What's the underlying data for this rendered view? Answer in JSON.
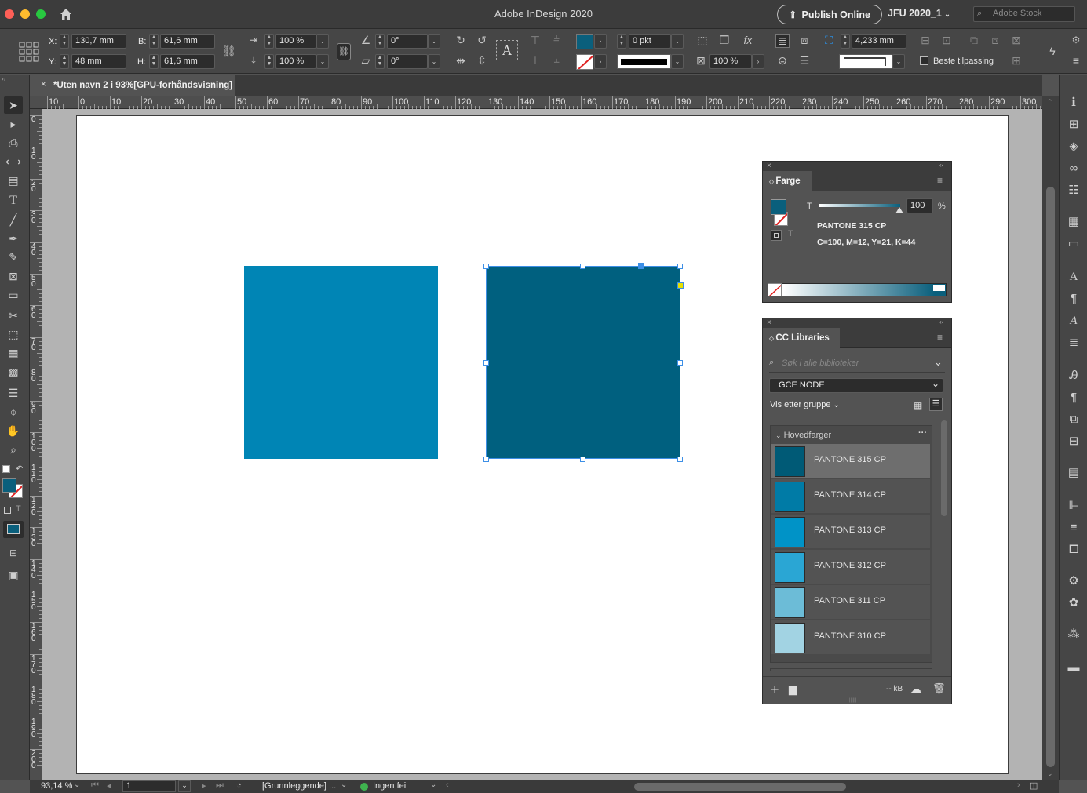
{
  "window": {
    "title": "Adobe InDesign 2020",
    "publish_label": "Publish Online",
    "workspace": "JFU 2020_1",
    "stock_placeholder": "Adobe Stock"
  },
  "control": {
    "x_label": "X:",
    "x_value": "130,7 mm",
    "y_label": "Y:",
    "y_value": "48 mm",
    "w_label": "B:",
    "w_value": "61,6 mm",
    "h_label": "H:",
    "h_value": "61,6 mm",
    "scale_x": "100 %",
    "scale_y": "100 %",
    "rotate": "0°",
    "shear": "0°",
    "stroke_weight": "0 pkt",
    "opacity": "100 %",
    "gap": "4,233 mm",
    "autofit_label": "Beste tilpassing"
  },
  "document": {
    "tab_label": "*Uten navn 2 i 93%[GPU-forhåndsvisning]"
  },
  "ruler": {
    "h_ticks": [
      "10",
      "0",
      "10",
      "20",
      "30",
      "40",
      "50",
      "60",
      "70",
      "80",
      "90",
      "100",
      "110",
      "120",
      "130",
      "140",
      "150",
      "160",
      "170",
      "180",
      "190",
      "200",
      "210",
      "220",
      "230",
      "240",
      "250",
      "260",
      "270",
      "280",
      "290",
      "300"
    ],
    "v_ticks": [
      "0",
      "1 0",
      "2 0",
      "3 0",
      "4 0",
      "5 0",
      "6 0",
      "7 0",
      "8 0",
      "9 0",
      "1 0 0",
      "1 1 0",
      "1 2 0",
      "1 3 0",
      "1 4 0",
      "1 5 0",
      "1 6 0",
      "1 7 0",
      "1 8 0",
      "1 9 0",
      "2 0 0"
    ]
  },
  "colors": {
    "square_left": "#0085b5",
    "square_right": "#00607f",
    "accent_fill": "#0a5f7c"
  },
  "color_panel": {
    "tab": "Farge",
    "tint_label": "T",
    "tint_value": "100",
    "percent": "%",
    "swatch_name": "PANTONE 315 CP",
    "cmyk": "C=100, M=12, Y=21, K=44"
  },
  "libraries_panel": {
    "tab": "CC Libraries",
    "search_placeholder": "Søk i alle biblioteker",
    "library": "GCE NODE",
    "view_by": "Vis etter gruppe",
    "group": "Hovedfarger",
    "size": "-- kB",
    "swatches": [
      {
        "name": "PANTONE 315 CP",
        "color": "#005a76"
      },
      {
        "name": "PANTONE 314 CP",
        "color": "#007ba6"
      },
      {
        "name": "PANTONE 313 CP",
        "color": "#0093c7"
      },
      {
        "name": "PANTONE 312 CP",
        "color": "#2aa6d4"
      },
      {
        "name": "PANTONE 311 CP",
        "color": "#6cbcd7"
      },
      {
        "name": "PANTONE 310 CP",
        "color": "#a2d3e3"
      }
    ]
  },
  "status": {
    "zoom": "93,14 %",
    "page": "1",
    "style": "[Grunnleggende] ...",
    "preflight": "Ingen feil"
  }
}
